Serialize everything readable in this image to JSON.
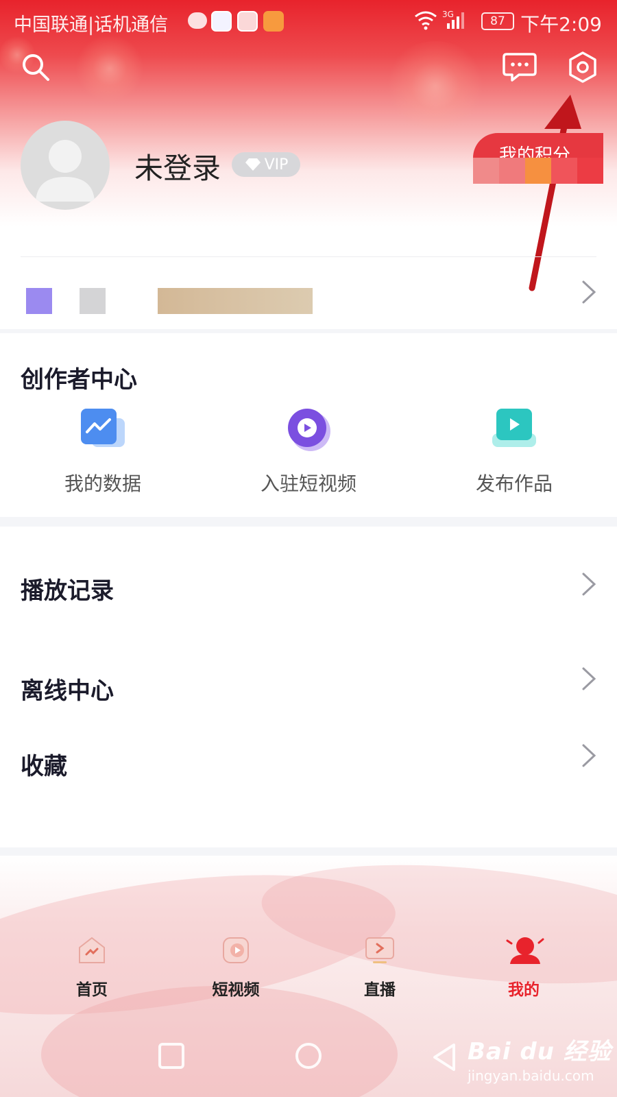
{
  "status_bar": {
    "carrier": "中国联通|话机通信",
    "network": "3G",
    "battery": "87",
    "time": "下午2:09"
  },
  "header": {
    "search_icon": "search-icon",
    "message_icon": "message-icon",
    "settings_icon": "settings-icon"
  },
  "profile": {
    "username": "未登录",
    "vip_label": "VIP",
    "points_button": "我的积分"
  },
  "creator_center": {
    "title": "创作者中心",
    "items": [
      {
        "label": "我的数据",
        "icon": "data-chart-icon",
        "color": "#4d8df0"
      },
      {
        "label": "入驻短视频",
        "icon": "play-circle-icon",
        "color": "#7b4fe0"
      },
      {
        "label": "发布作品",
        "icon": "publish-video-icon",
        "color": "#2cc6c0"
      }
    ]
  },
  "menu": {
    "items": [
      {
        "label": "播放记录"
      },
      {
        "label": "离线中心"
      },
      {
        "label": "收藏"
      }
    ]
  },
  "bottom_nav": {
    "tabs": [
      {
        "label": "首页",
        "active": false
      },
      {
        "label": "短视频",
        "active": false
      },
      {
        "label": "直播",
        "active": false
      },
      {
        "label": "我的",
        "active": true
      }
    ]
  },
  "watermark": {
    "brand": "Bai du 经验",
    "url": "jingyan.baidu.com"
  },
  "colors": {
    "brand_red": "#e8232c",
    "text_dark": "#1b1b2b",
    "text_gray": "#555555"
  }
}
